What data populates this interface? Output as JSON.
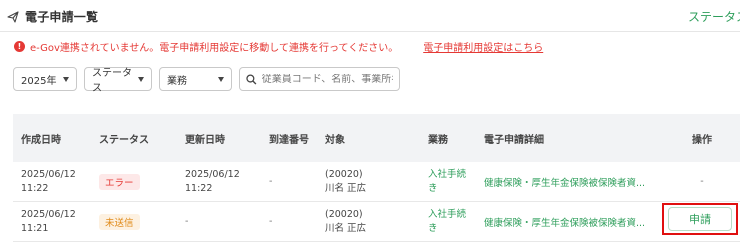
{
  "header": {
    "title": "電子申請一覧",
    "status_link": "ステータス"
  },
  "alert": {
    "message": "e-Gov連携されていません。電子申請利用設定に移動して連携を行ってください。",
    "link": "電子申請利用設定はこちら",
    "color": "#e53935"
  },
  "filters": {
    "year": "2025年",
    "status": "ステータス",
    "business": "業務",
    "search_placeholder": "従業員コード、名前、事業所名"
  },
  "table": {
    "headers": [
      "作成日時",
      "ステータス",
      "更新日時",
      "到達番号",
      "対象",
      "業務",
      "電子申請詳細",
      "操作"
    ],
    "rows": [
      {
        "created_date": "2025/06/12",
        "created_time": "11:22",
        "status": "エラー",
        "updated_date": "2025/06/12",
        "updated_time": "11:22",
        "arrival_no": "-",
        "target_code": "(20020)",
        "target_name": "川名 正広",
        "business_line1": "入社手続",
        "business_line2": "き",
        "detail": "健康保険・厚生年金保険被保険者資...",
        "action": "-"
      },
      {
        "created_date": "2025/06/12",
        "created_time": "11:21",
        "status": "未送信",
        "updated_date": "-",
        "updated_time": "",
        "arrival_no": "-",
        "target_code": "(20020)",
        "target_name": "川名 正広",
        "business_line1": "入社手続",
        "business_line2": "き",
        "detail": "健康保険・厚生年金保険被保険者資...",
        "action": "申請"
      }
    ]
  },
  "colors": {
    "accent_green": "#2e9e5b",
    "error_red": "#e53935",
    "pending_orange": "#e08a19",
    "highlight_border": "#e01010"
  }
}
